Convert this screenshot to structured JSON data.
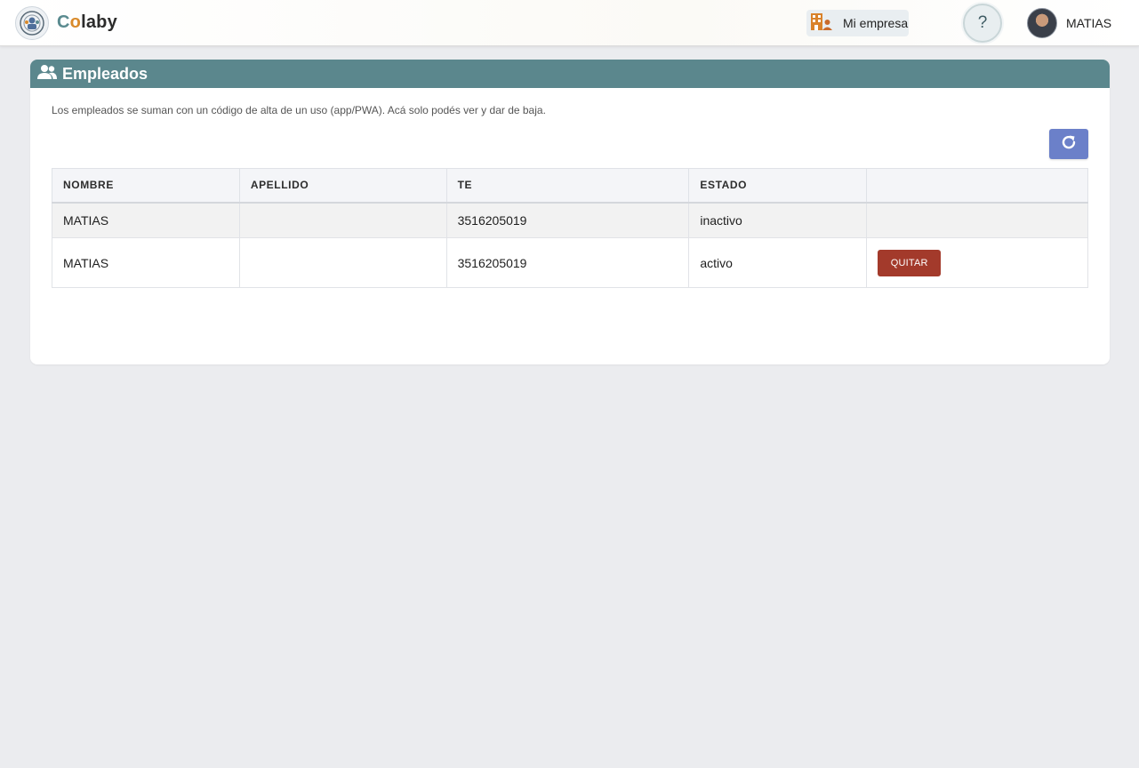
{
  "header": {
    "brand": {
      "part1": "C",
      "part2": "o",
      "part3": "laby"
    },
    "company_button_label": "Mi empresa",
    "help_label": "?",
    "user_name": "MATIAS"
  },
  "card": {
    "title": "Empleados",
    "info_text": "Los empleados se suman con un código de alta de un uso (app/PWA). Acá solo podés ver y dar de baja.",
    "table": {
      "columns": [
        "NOMBRE",
        "APELLIDO",
        "TE",
        "ESTADO",
        ""
      ],
      "rows": [
        {
          "nombre": "MATIAS",
          "apellido": "",
          "te": "3516205019",
          "estado": "inactivo",
          "action": ""
        },
        {
          "nombre": "MATIAS",
          "apellido": "",
          "te": "3516205019",
          "estado": "activo",
          "action": "QUITAR"
        }
      ]
    }
  },
  "colors": {
    "header_teal": "#5b878d",
    "refresh_blue": "#6b80c9",
    "remove_red": "#a33a2b",
    "page_bg": "#ebecef"
  },
  "icons": {
    "logo": "colaby-logo-icon",
    "company": "building-icon",
    "help": "help-icon",
    "avatar": "user-avatar",
    "title": "users-icon",
    "refresh": "refresh-icon"
  }
}
